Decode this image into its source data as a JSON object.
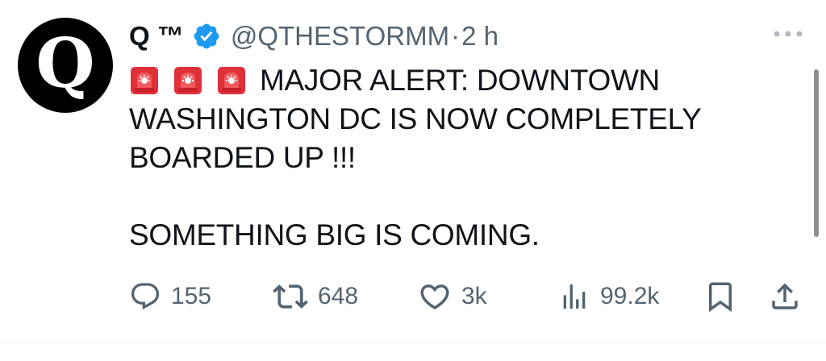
{
  "avatar": {
    "letter": "Q",
    "bg_color": "#000000"
  },
  "header": {
    "display_name": "Q ™",
    "handle": "@QTHESTORMM",
    "separator": "·",
    "time": "2 h",
    "verified_color": "#1d9bf0"
  },
  "tweet": {
    "siren_icon": "police-car-light-emoji",
    "siren_count": 3,
    "line1": "MAJOR ALERT: DOWNTOWN",
    "line2": "WASHINGTON DC IS NOW COMPLETELY",
    "line3": "BOARDED UP !!!",
    "line4": "SOMETHING BIG IS COMING."
  },
  "actions": {
    "replies": {
      "icon": "reply-icon",
      "count": "155"
    },
    "retweets": {
      "icon": "retweet-icon",
      "count": "648"
    },
    "likes": {
      "icon": "heart-icon",
      "count": "3k"
    },
    "views": {
      "icon": "views-icon",
      "count": "99.2k"
    },
    "bookmark": {
      "icon": "bookmark-icon"
    },
    "share": {
      "icon": "share-icon"
    }
  },
  "colors": {
    "text": "#0f1419",
    "secondary": "#536471",
    "siren_red": "#e0303a"
  }
}
